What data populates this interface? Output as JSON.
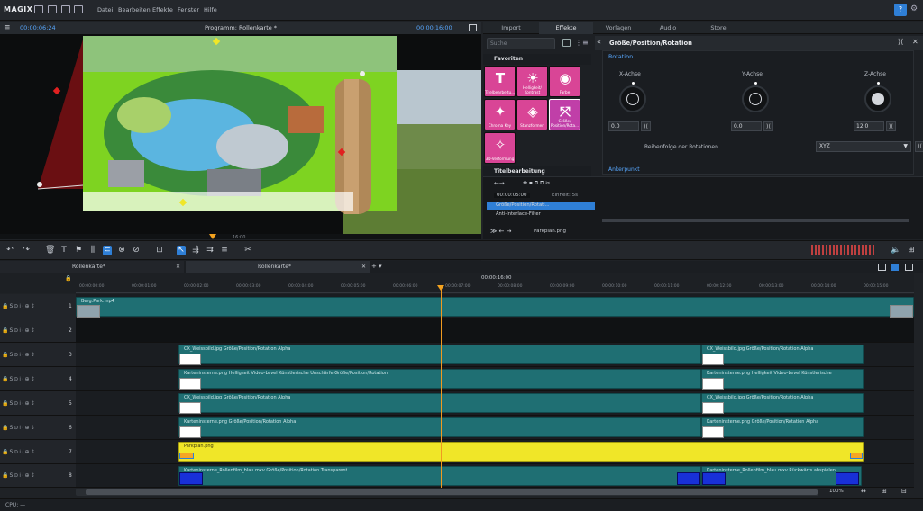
{
  "app": {
    "logo": "MAGIX",
    "menu": [
      "Datei",
      "Bearbeiten",
      "Effekte",
      "Fenster",
      "Hilfe"
    ],
    "help_badge": "?"
  },
  "monitor": {
    "timecode_left": "00:00:06:24",
    "title": "Programm: Rollenkarte *",
    "timecode_right": "00:00:16:00",
    "scrub_label": "16:00",
    "playhead_fraction": 0.44
  },
  "panel": {
    "tabs": [
      "Import",
      "Effekte",
      "Vorlagen",
      "Audio",
      "Store"
    ],
    "active_tab": "Effekte",
    "search_placeholder": "Suche",
    "categories": [
      "Favoriten",
      "Titelbearbeitung"
    ],
    "tiles": [
      {
        "label": "Titelbearbeitu...",
        "icon": "T",
        "color": "#d94596"
      },
      {
        "label": "Helligkeit/ Kontrast",
        "icon": "☀",
        "color": "#d94596"
      },
      {
        "label": "Farbe",
        "icon": "◉",
        "color": "#d94596"
      },
      {
        "label": "Chroma Key",
        "icon": "✦",
        "color": "#d94596"
      },
      {
        "label": "Stanzformen",
        "icon": "◈",
        "color": "#d94596"
      },
      {
        "label": "Größe/ Position/Rota...",
        "icon": "⤧",
        "color": "#c03fa8"
      },
      {
        "label": "3D-Verformung",
        "icon": "✧",
        "color": "#d94596"
      }
    ],
    "props_title": "Größe/Position/Rotation",
    "section_rotation": "Rotation",
    "axes": [
      {
        "label": "X-Achse",
        "value": "0.0"
      },
      {
        "label": "Y-Achse",
        "value": "0.0"
      },
      {
        "label": "Z-Achse",
        "value": "12.0"
      }
    ],
    "order_label": "Reihenfolge der Rotationen",
    "order_value": "XYZ",
    "next_section": "Ankerpunkt",
    "kf_time": "00:00:05:00",
    "kf_unit": "Einheit: 5s",
    "kf_rows": [
      "Größe/Position/Rotati...",
      "Anti-Interlace-Filter"
    ],
    "kf_file": "Parkplan.png"
  },
  "project_tabs": [
    "Rollenkarte*",
    "Rollenkarte*"
  ],
  "ruler": {
    "center_tc": "00:00:16:00",
    "ticks": [
      "00:00:00:00",
      "00:00:01:00",
      "00:00:02:00",
      "00:00:03:00",
      "00:00:04:00",
      "00:00:05:00",
      "00:00:06:00",
      "00:00:07:00",
      "00:00:08:00",
      "00:00:09:00",
      "00:00:10:00",
      "00:00:11:00",
      "00:00:12:00",
      "00:00:13:00",
      "00:00:14:00",
      "00:00:15:00"
    ]
  },
  "tracks": [
    {
      "num": "1",
      "clips": [
        {
          "label": "Berg.Park.mp4"
        }
      ]
    },
    {
      "num": "2",
      "clips": []
    },
    {
      "num": "3",
      "clips": [
        {
          "label": "CX_Weissbild.jpg  Größe/Position/Rotation Alpha"
        },
        {
          "label": "CX_Weissbild.jpg  Größe/Position/Rotation Alpha"
        }
      ]
    },
    {
      "num": "4",
      "clips": [
        {
          "label": "Karteninsterne.png  Helligkeit Video-Level Künstlerische Unschärfe Größe/Position/Rotation"
        },
        {
          "label": "Karteninsterne.png  Helligkeit Video-Level Künstlerische"
        }
      ]
    },
    {
      "num": "5",
      "clips": [
        {
          "label": "CX_Weissbild.jpg  Größe/Position/Rotation Alpha"
        },
        {
          "label": "CX_Weissbild.jpg  Größe/Position/Rotation Alpha"
        }
      ]
    },
    {
      "num": "6",
      "clips": [
        {
          "label": "Karteninsterne.png  Größe/Position/Rotation Alpha"
        },
        {
          "label": "Karteninsterne.png  Größe/Position/Rotation Alpha"
        }
      ]
    },
    {
      "num": "7",
      "clips": [
        {
          "label": "Parkplan.png"
        }
      ]
    },
    {
      "num": "8",
      "clips": [
        {
          "label": "Karteninsterne_Rollenfilm_blau.mxv  Größe/Position/Rotation Transparent"
        },
        {
          "label": "Karteninsterne_Rollenfilm_blau.mxv  Rückwärts abspielen"
        }
      ]
    }
  ],
  "status": {
    "cpu": "CPU: —",
    "zoom": "100%"
  }
}
